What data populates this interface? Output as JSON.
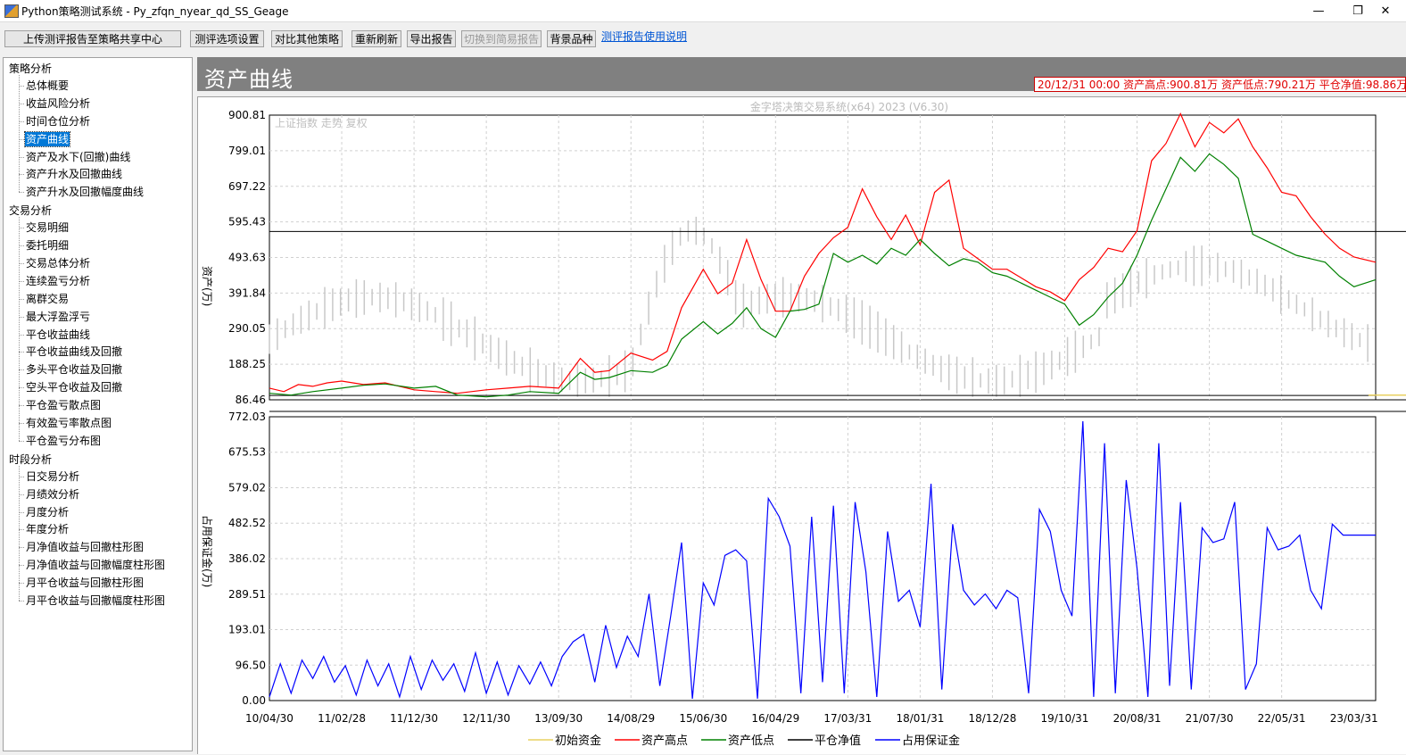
{
  "window": {
    "title": "Python策略测试系统 - Py_zfqn_nyear_qd_SS_Geage",
    "minimize_glyph": "—",
    "restore_glyph": "❐",
    "close_glyph": "✕"
  },
  "toolbar": {
    "upload_label": "上传测评报告至策略共享中心",
    "options_label": "测评选项设置",
    "compare_label": "对比其他策略",
    "refresh_label": "重新刷新",
    "export_label": "导出报告",
    "simple_label": "切换到简易报告",
    "bg_label": "背景品种",
    "help_link": "测评报告使用说明"
  },
  "sidebar": {
    "groups": [
      {
        "label": "策略分析",
        "items": [
          "总体概要",
          "收益风险分析",
          "时间仓位分析",
          "资产曲线",
          "资产及水下(回撤)曲线",
          "资产升水及回撤曲线",
          "资产升水及回撤幅度曲线"
        ]
      },
      {
        "label": "交易分析",
        "items": [
          "交易明细",
          "委托明细",
          "交易总体分析",
          "连续盈亏分析",
          "离群交易",
          "最大浮盈浮亏",
          "平仓收益曲线",
          "平仓收益曲线及回撤",
          "多头平仓收益及回撤",
          "空头平仓收益及回撤",
          "平仓盈亏散点图",
          "有效盈亏率散点图",
          "平仓盈亏分布图"
        ]
      },
      {
        "label": "时段分析",
        "items": [
          "日交易分析",
          "月绩效分析",
          "月度分析",
          "年度分析",
          "月净值收益与回撤柱形图",
          "月净值收益与回撤幅度柱形图",
          "月平仓收益与回撤柱形图",
          "月平仓收益与回撤幅度柱形图"
        ]
      }
    ],
    "selected": "资产曲线"
  },
  "panel": {
    "title": "资产曲线",
    "info": "20/12/31 00:00 资产高点:900.81万  资产低点:790.21万  平仓净值:98.86万"
  },
  "colors": {
    "initial": "#e8d060",
    "high": "#ff0000",
    "low": "#008000",
    "net": "#000000",
    "margin": "#0000ff",
    "background": "#c8c8c8"
  },
  "chart_data": [
    {
      "type": "line",
      "watermark": "金字塔决策交易系统(x64) 2023 (V6.30)",
      "background_label": "上证指数 走势 复权",
      "ylabel": "资产(万)",
      "ylim": [
        86.46,
        900.81
      ],
      "yticks": [
        "900.81",
        "799.01",
        "697.22",
        "595.43",
        "493.63",
        "391.84",
        "290.05",
        "188.25",
        "86.46"
      ],
      "xticks": [
        "10/04/30",
        "11/02/28",
        "11/12/30",
        "12/11/30",
        "13/09/30",
        "14/08/29",
        "15/06/30",
        "16/04/29",
        "17/03/31",
        "18/01/31",
        "18/12/28",
        "19/10/31",
        "20/08/31",
        "21/07/30",
        "22/05/31",
        "23/03/31"
      ],
      "grid": true,
      "crosshair_x": 20.6,
      "series": [
        {
          "name": "初始资金",
          "values": [
            100,
            100
          ]
        },
        {
          "name": "资产高点",
          "x": [
            0,
            0.2,
            0.4,
            0.6,
            0.8,
            1,
            1.3,
            1.6,
            2,
            2.3,
            2.6,
            3,
            3.3,
            3.6,
            4,
            4.3,
            4.5,
            4.7,
            5,
            5.3,
            5.5,
            5.7,
            6,
            6.2,
            6.4,
            6.6,
            6.8,
            7,
            7.2,
            7.4,
            7.6,
            7.8,
            8,
            8.2,
            8.4,
            8.6,
            8.8,
            9,
            9.2,
            9.4,
            9.6,
            9.8,
            10,
            10.2,
            10.4,
            10.6,
            10.8,
            11,
            11.2,
            11.4,
            11.6,
            11.8,
            12,
            12.2,
            12.4,
            12.6,
            12.8,
            13,
            13.2,
            13.4,
            13.6,
            13.8,
            14,
            14.2,
            14.4,
            14.6,
            14.8,
            15,
            15.3
          ],
          "values": [
            120,
            110,
            130,
            125,
            135,
            140,
            130,
            135,
            115,
            110,
            105,
            115,
            120,
            125,
            120,
            205,
            165,
            170,
            220,
            200,
            225,
            350,
            460,
            390,
            420,
            545,
            430,
            340,
            340,
            440,
            505,
            550,
            580,
            690,
            610,
            545,
            615,
            530,
            680,
            715,
            520,
            490,
            460,
            460,
            435,
            410,
            395,
            370,
            430,
            465,
            520,
            510,
            570,
            770,
            820,
            905,
            810,
            880,
            850,
            890,
            810,
            750,
            680,
            670,
            610,
            560,
            520,
            495,
            480
          ]
        },
        {
          "name": "资产低点",
          "x": [
            0,
            0.3,
            0.6,
            1,
            1.3,
            1.6,
            2,
            2.3,
            2.6,
            3,
            3.3,
            3.6,
            4,
            4.3,
            4.5,
            4.7,
            5,
            5.3,
            5.5,
            5.7,
            6,
            6.2,
            6.4,
            6.6,
            6.8,
            7,
            7.2,
            7.4,
            7.6,
            7.8,
            8,
            8.2,
            8.4,
            8.6,
            8.8,
            9,
            9.2,
            9.4,
            9.6,
            9.8,
            10,
            10.2,
            10.4,
            10.6,
            10.8,
            11,
            11.2,
            11.4,
            11.6,
            11.8,
            12,
            12.2,
            12.4,
            12.6,
            12.8,
            13,
            13.2,
            13.4,
            13.6,
            13.8,
            14,
            14.2,
            14.4,
            14.6,
            14.8,
            15,
            15.3
          ],
          "values": [
            105,
            100,
            110,
            120,
            128,
            132,
            120,
            125,
            100,
            95,
            100,
            110,
            105,
            165,
            145,
            150,
            170,
            165,
            185,
            260,
            310,
            275,
            305,
            350,
            290,
            265,
            340,
            345,
            360,
            505,
            480,
            500,
            475,
            520,
            500,
            545,
            505,
            470,
            490,
            480,
            450,
            440,
            420,
            400,
            380,
            360,
            300,
            330,
            380,
            420,
            500,
            600,
            690,
            780,
            740,
            790,
            760,
            720,
            560,
            540,
            520,
            500,
            490,
            480,
            440,
            410,
            430
          ]
        },
        {
          "name": "平仓净值",
          "values": [
            98.86,
            98.86
          ]
        }
      ],
      "hlines": [
        568,
        98.86
      ]
    },
    {
      "type": "line",
      "ylabel": "占用保证金(万)",
      "ylim": [
        0,
        772.03
      ],
      "yticks": [
        "772.03",
        "675.53",
        "579.02",
        "482.52",
        "386.02",
        "289.51",
        "193.01",
        "96.50",
        "0.00"
      ],
      "series": [
        {
          "name": "占用保证金",
          "x": [
            0,
            0.15,
            0.3,
            0.45,
            0.6,
            0.75,
            0.9,
            1.05,
            1.2,
            1.35,
            1.5,
            1.65,
            1.8,
            1.95,
            2.1,
            2.25,
            2.4,
            2.55,
            2.7,
            2.85,
            3,
            3.15,
            3.3,
            3.45,
            3.6,
            3.75,
            3.9,
            4.05,
            4.2,
            4.35,
            4.5,
            4.65,
            4.8,
            4.95,
            5.1,
            5.25,
            5.4,
            5.55,
            5.7,
            5.85,
            6,
            6.15,
            6.3,
            6.45,
            6.6,
            6.75,
            6.9,
            7.05,
            7.2,
            7.35,
            7.5,
            7.65,
            7.8,
            7.95,
            8.1,
            8.25,
            8.4,
            8.55,
            8.7,
            8.85,
            9,
            9.15,
            9.3,
            9.45,
            9.6,
            9.75,
            9.9,
            10.05,
            10.2,
            10.35,
            10.5,
            10.65,
            10.8,
            10.95,
            11.1,
            11.25,
            11.4,
            11.55,
            11.7,
            11.85,
            12,
            12.15,
            12.3,
            12.45,
            12.6,
            12.75,
            12.9,
            13.05,
            13.2,
            13.35,
            13.5,
            13.65,
            13.8,
            13.95,
            14.1,
            14.25,
            14.4,
            14.55,
            14.7,
            14.85,
            15,
            15.3
          ],
          "values": [
            10,
            100,
            20,
            110,
            60,
            120,
            50,
            95,
            15,
            110,
            40,
            100,
            10,
            120,
            30,
            110,
            55,
            100,
            25,
            130,
            20,
            105,
            15,
            95,
            45,
            105,
            40,
            120,
            160,
            180,
            50,
            205,
            90,
            175,
            120,
            290,
            40,
            230,
            430,
            5,
            320,
            260,
            395,
            410,
            380,
            5,
            550,
            500,
            420,
            20,
            500,
            50,
            530,
            20,
            540,
            350,
            10,
            460,
            270,
            300,
            200,
            590,
            30,
            480,
            300,
            260,
            290,
            250,
            300,
            280,
            20,
            520,
            460,
            300,
            230,
            760,
            10,
            700,
            20,
            600,
            360,
            10,
            700,
            40,
            540,
            30,
            470,
            430,
            440,
            540,
            30,
            100,
            470,
            410,
            420,
            450,
            300,
            250,
            480,
            450,
            450,
            450
          ]
        }
      ]
    }
  ],
  "legend": [
    "初始资金",
    "资产高点",
    "资产低点",
    "平仓净值",
    "占用保证金"
  ]
}
